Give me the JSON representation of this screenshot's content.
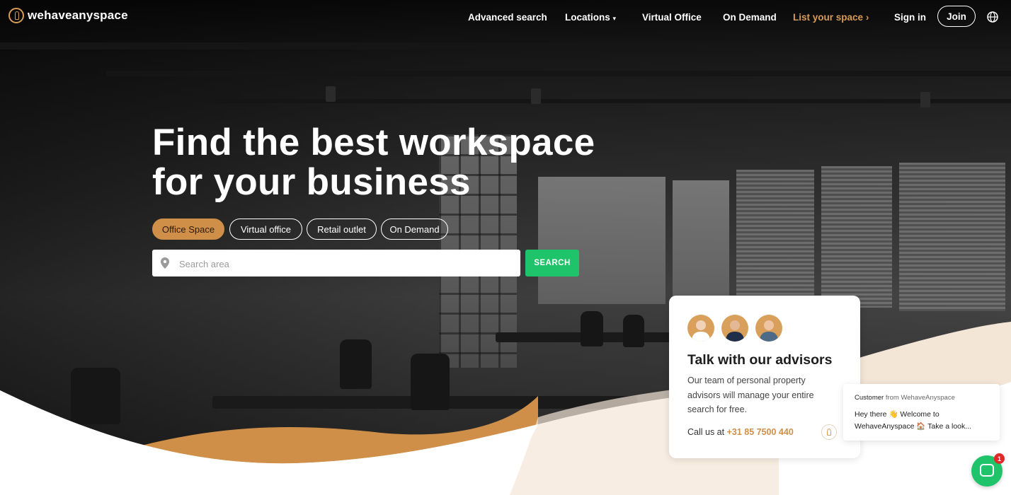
{
  "brand": {
    "name": "wehaveanyspace",
    "accent": "#d79b55"
  },
  "nav": {
    "advanced_search": "Advanced search",
    "locations": "Locations",
    "virtual_office": "Virtual Office",
    "on_demand": "On Demand",
    "list_your_space": "List your space",
    "sign_in": "Sign in",
    "join": "Join"
  },
  "hero": {
    "headline_line1": "Find the best workspace",
    "headline_line2": "for your business",
    "tabs": [
      {
        "label": "Office Space",
        "active": true
      },
      {
        "label": "Virtual office",
        "active": false
      },
      {
        "label": "Retail outlet",
        "active": false
      },
      {
        "label": "On Demand",
        "active": false
      }
    ],
    "search": {
      "placeholder": "Search area",
      "button": "SEARCH",
      "button_color": "#1fc46a"
    }
  },
  "advisors": {
    "title": "Talk with our advisors",
    "description": "Our team of personal property advisors will manage your entire search for free.",
    "call_prefix": "Call us at",
    "phone": "+31 85 7500 440"
  },
  "chat": {
    "sender": "Customer",
    "from_label": "from WehaveAnyspace",
    "message": "Hey there 👋 Welcome to WehaveAnyspace 🏠 Take a look...",
    "unread": "1"
  }
}
